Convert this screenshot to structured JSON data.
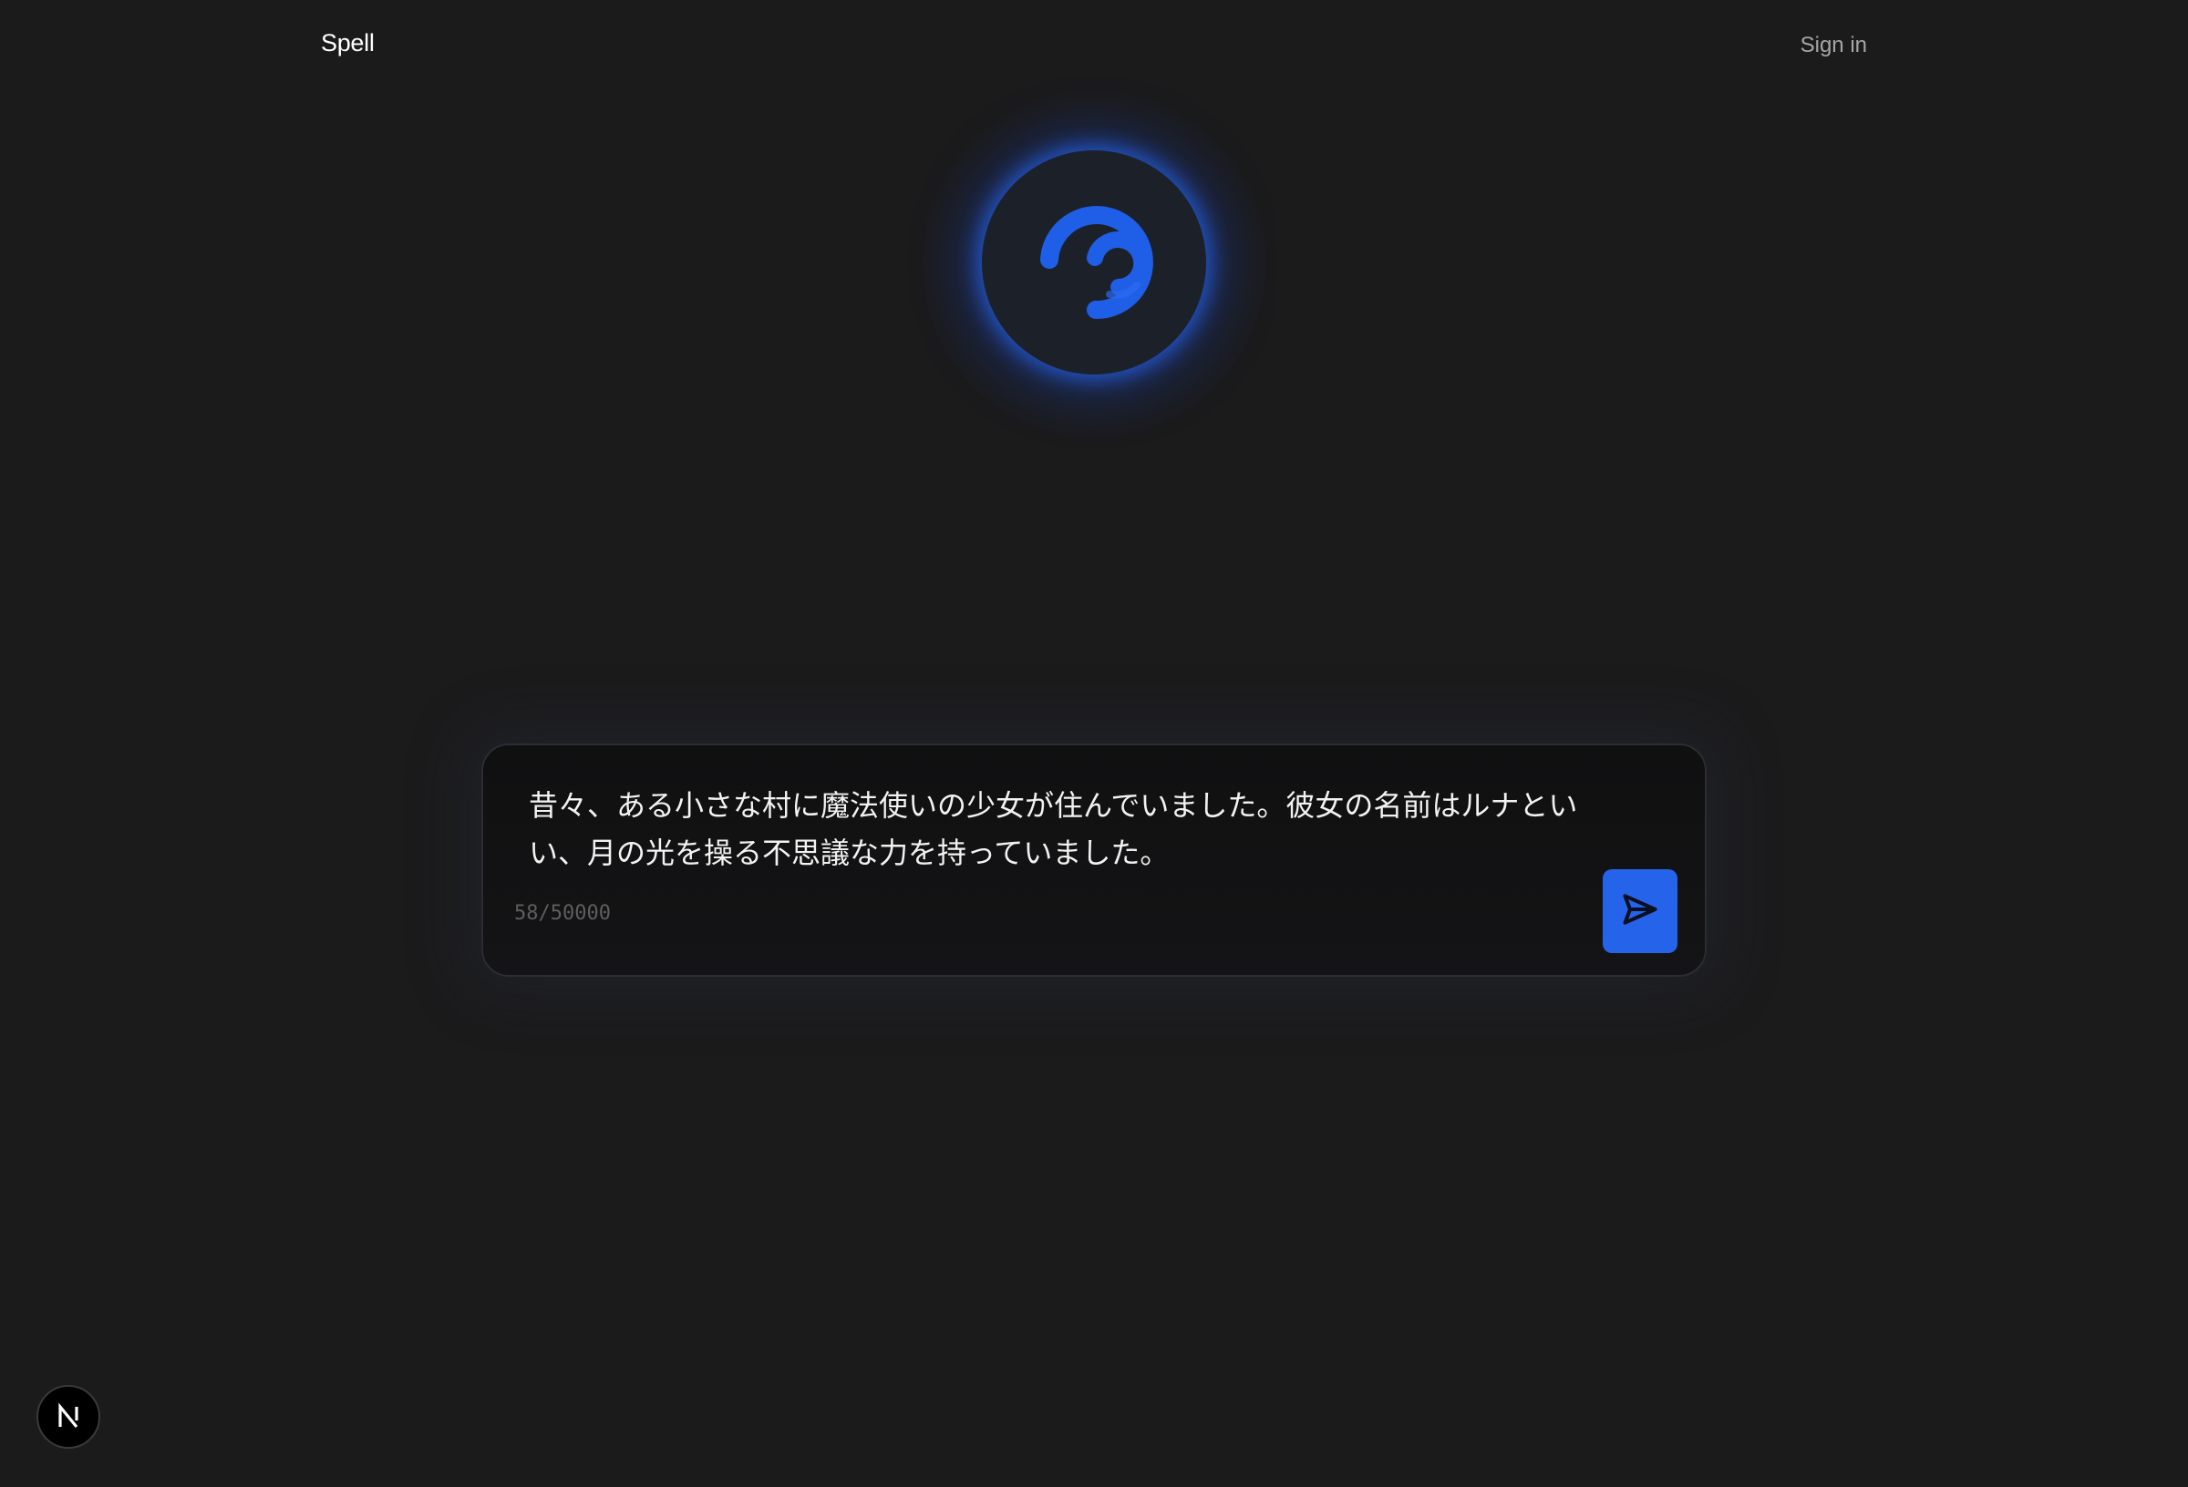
{
  "header": {
    "brand": "Spell",
    "signin_label": "Sign in"
  },
  "orb": {
    "icon": "spiral-loading-icon",
    "accent_color": "#2563eb"
  },
  "composer": {
    "text": "昔々、ある小さな村に魔法使いの少女が住んでいました。彼女の名前はルナといい、月の光を操る不思議な力を持っていました。",
    "counter": "58/50000",
    "send_icon": "send-icon"
  },
  "footer": {
    "badge_icon": "nextjs-logo-icon"
  }
}
